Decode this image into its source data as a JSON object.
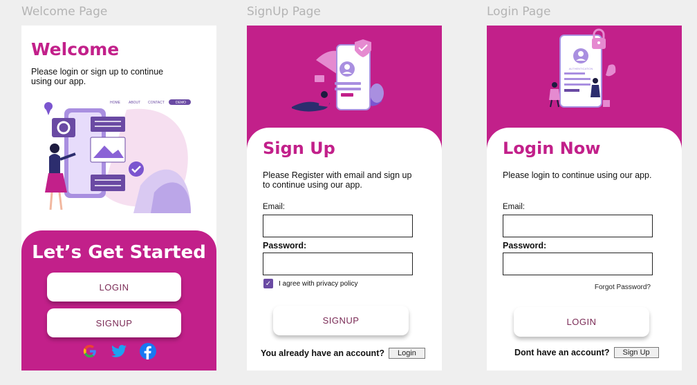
{
  "labels": {
    "welcome_frame": "Welcome Page",
    "signup_frame": "SignUp Page",
    "login_frame": "Login Page"
  },
  "welcome": {
    "title": "Welcome",
    "subtitle": "Please login or sign up to continue using our app.",
    "illus_nav": [
      "HOME",
      "ABOUT",
      "CONTACT",
      "DEMO"
    ],
    "cta_title": "Let’s Get Started",
    "login_label": "LOGIN",
    "signup_label": "SIGNUP",
    "socials": [
      "google-icon",
      "twitter-icon",
      "facebook-icon"
    ]
  },
  "signup": {
    "title": "Sign Up",
    "subtitle": "Please Register with email and sign up to continue using our app.",
    "email_label": "Email:",
    "email_value": "",
    "password_label": "Password:",
    "password_value": "",
    "agree_text": "I agree with privacy policy",
    "agree_checked": true,
    "signup_label": "SIGNUP",
    "account_prompt": "You already have an account?",
    "login_link": "Login"
  },
  "login": {
    "illus_caption": "AUTHENTICATION",
    "title": "Login Now",
    "subtitle": "Please login to continue using our app.",
    "email_label": "Email:",
    "email_value": "",
    "password_label": "Password:",
    "password_value": "",
    "forgot_label": "Forgot Password?",
    "login_label": "LOGIN",
    "account_prompt": "Dont have an account?",
    "signup_link": "Sign Up"
  },
  "colors": {
    "brand": "#c2208a",
    "purple": "#6a4aa3",
    "button_text": "#7a2a55"
  }
}
